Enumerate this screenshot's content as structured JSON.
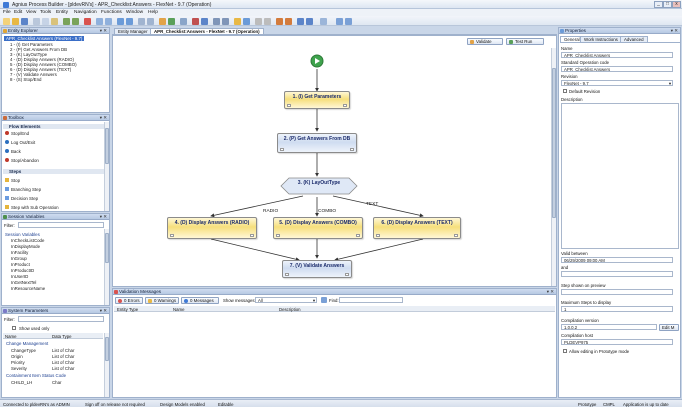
{
  "window": {
    "title": "Agnius Process Builder - [pldevRN's] - APR_Checklist:Answers - FlexNet - 9.7 (Operation)",
    "controls": {
      "min": "_",
      "max": "□",
      "close": "x"
    }
  },
  "menu": [
    "File",
    "Edit",
    "View",
    "Tools",
    "Entity",
    "Navigation",
    "Functions",
    "Window",
    "Help"
  ],
  "entity_explorer": {
    "title": "Entity Explorer",
    "root": "APR_Checklist Answers (FlexNet - 9.7)",
    "items": [
      "1 - (I) Get Parameters",
      "2 - (P) Get Answers From DB",
      "3 - (K) LayOutType",
      "4 - (D) Display Answers (RADIO)",
      "5 - (D) Display Answers (COMBO)",
      "6 - (D) Display Answers (TEXT)",
      "7 - (V) Validate Answers",
      "8 - (S) Stop/End"
    ]
  },
  "toolbox": {
    "title": "Toolbox",
    "groups": [
      {
        "name": "Flow Elements",
        "items": [
          "Stop/End",
          "Log Out/Exit",
          "Back",
          "Stop/Abandon"
        ]
      },
      {
        "name": "Steps",
        "items": [
          "Stop",
          "Branching Step",
          "Decision Step",
          "Step with Sub Operation"
        ]
      }
    ]
  },
  "session_variables": {
    "title": "Session Variables",
    "filter_label": "Filter:",
    "group": "Session Variables",
    "items": [
      "InCheckListCode",
      "InDisplayMode",
      "InFacility",
      "InGroup",
      "InProduct",
      "InProductID",
      "InUserID",
      "InGetNextTel",
      "InResourceName"
    ]
  },
  "system_parameters": {
    "title": "System Parameters",
    "filter_label": "Filter:",
    "show_used_only": "Show used only",
    "columns": [
      "Name",
      "Data Type"
    ],
    "groups": [
      {
        "name": "Change Management",
        "rows": [
          [
            "ChangeType",
            "List of Char"
          ],
          [
            "Origin",
            "List of Char"
          ],
          [
            "Priority",
            "List of Char"
          ],
          [
            "Severity",
            "List of Char"
          ]
        ]
      },
      {
        "name": "Containment Item Status Code",
        "rows": [
          [
            "CHILD_LH",
            "Char"
          ]
        ]
      }
    ]
  },
  "document_tabs": [
    "Entity Manager",
    "APR_Checklist:Answers - FlexNet - 9.7 (Operation)"
  ],
  "canvas_toolbar": {
    "validate": "Validate",
    "test_run": "Test Run"
  },
  "flow_nodes": {
    "n1": "1. (I) Get Parameters",
    "n2": "2. (P) Get Answers From DB",
    "n3": "3. (K) LayOutType",
    "n4": "4. (D) Display Answers (RADIO)",
    "n5": "5. (D) Display Answers (COMBO)",
    "n6": "6. (D) Display Answers (TEXT)",
    "n7": "7. (V) Validate Answers"
  },
  "flow_edges": {
    "radio": "RADIO",
    "combo": "COMBO",
    "text": "TEXT"
  },
  "validation": {
    "title": "Validation Messages",
    "errors": "0 Errors",
    "warnings": "0 Warnings",
    "messages": "0 Messages",
    "show_label": "Show messages:",
    "show_value": "All",
    "find_label": "Find:",
    "columns": [
      "Entity Type",
      "Name",
      "Description"
    ]
  },
  "properties": {
    "title": "Properties",
    "tabs": [
      "General",
      "Work Instructions",
      "Advanced"
    ],
    "name_label": "Name",
    "name_value": "APR_Checklist Answers",
    "std_code_label": "Standard Operation code",
    "std_code_value": "APR_Checklist Answers",
    "revision_label": "Revision",
    "revision_value": "FlexNet - 9.7",
    "default_revision": "Default Revision",
    "description_label": "Description",
    "valid_between_label": "Valid between",
    "valid_from": "06/29/2009 09:00 AM",
    "and_label": "and",
    "step_shown_label": "Step shown on preview",
    "max_steps_label": "Maximum Steps to display",
    "max_steps_value": "1",
    "compilation_version_label": "Compilation version",
    "compilation_version_value": "1.0.0.2",
    "edit_button": "Edit M",
    "compilation_host_label": "Compilation host",
    "compilation_host_value": "PLDEVP975",
    "prototype_checkbox": "Allow editing in Prototype mode"
  },
  "status": {
    "connected": "Connected to pldevRN's as ADMIN",
    "signoff": "Sign off on release not required",
    "design_mode": "Design Models enabled",
    "editable": "Editable",
    "prototype": "Prototype",
    "cmpl": "CMPL",
    "app_status": "Application is up to date"
  },
  "colors": {
    "accent": "#3f7ad6",
    "panel_header": "#c4d4ea",
    "node_yellow": "#f6df7c",
    "node_blue": "#cfdcf0"
  }
}
